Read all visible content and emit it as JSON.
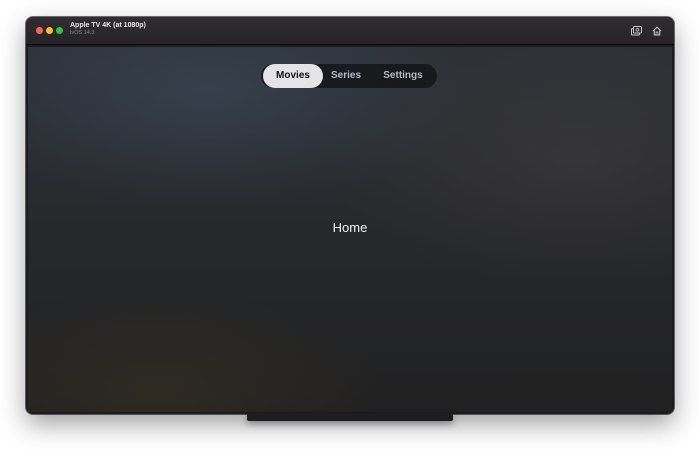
{
  "window": {
    "title": "Apple TV 4K (at 1080p)",
    "subtitle": "tvOS 14.3"
  },
  "toolbar": {
    "icons": [
      "screenshot-icon",
      "home-icon"
    ]
  },
  "tabs": [
    {
      "label": "Movies",
      "selected": true
    },
    {
      "label": "Series",
      "selected": false
    },
    {
      "label": "Settings",
      "selected": false
    }
  ],
  "content": {
    "label": "Home"
  },
  "colors": {
    "tab_selected_bg": "#e4e4e7",
    "tab_bar_bg": "#121216",
    "close": "#ff5f57",
    "minimize": "#febc2e",
    "zoom": "#28c840"
  }
}
